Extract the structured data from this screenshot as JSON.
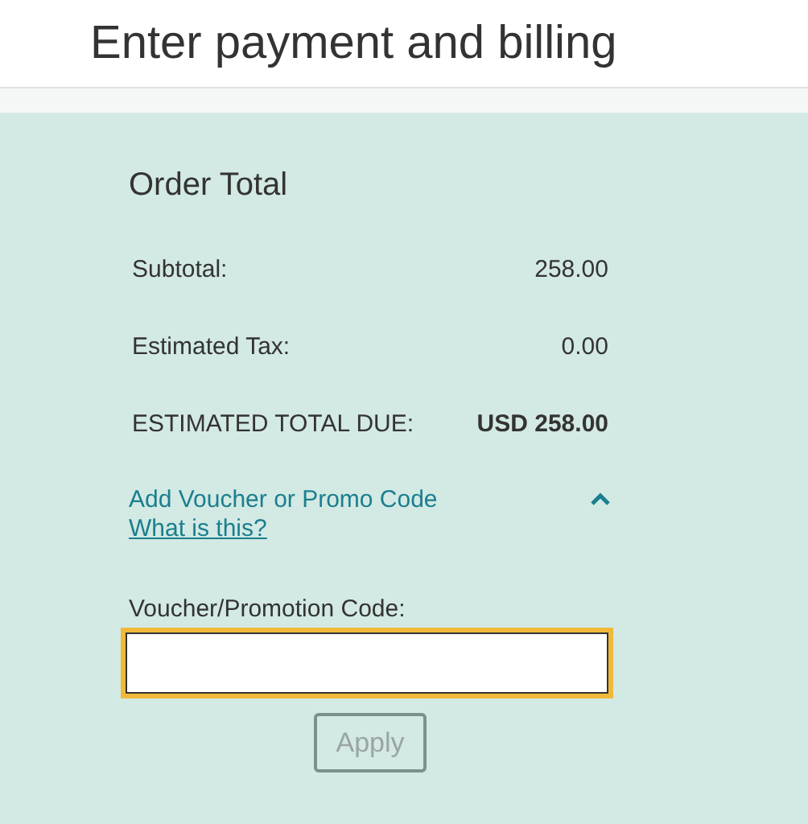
{
  "page_title": "Enter payment and billing",
  "order_total": {
    "heading": "Order Total",
    "rows": [
      {
        "label": "Subtotal:",
        "value": "258.00",
        "emphasis": false
      },
      {
        "label": "Estimated Tax:",
        "value": "0.00",
        "emphasis": false
      },
      {
        "label": "ESTIMATED TOTAL DUE:",
        "value": "USD 258.00",
        "emphasis": true
      }
    ]
  },
  "voucher": {
    "toggle_label": "Add Voucher or Promo Code",
    "expanded": true,
    "help_link": "What is this?",
    "field_label": "Voucher/Promotion Code:",
    "field_focused": true,
    "apply_button": {
      "label": "Apply",
      "disabled": true
    }
  }
}
